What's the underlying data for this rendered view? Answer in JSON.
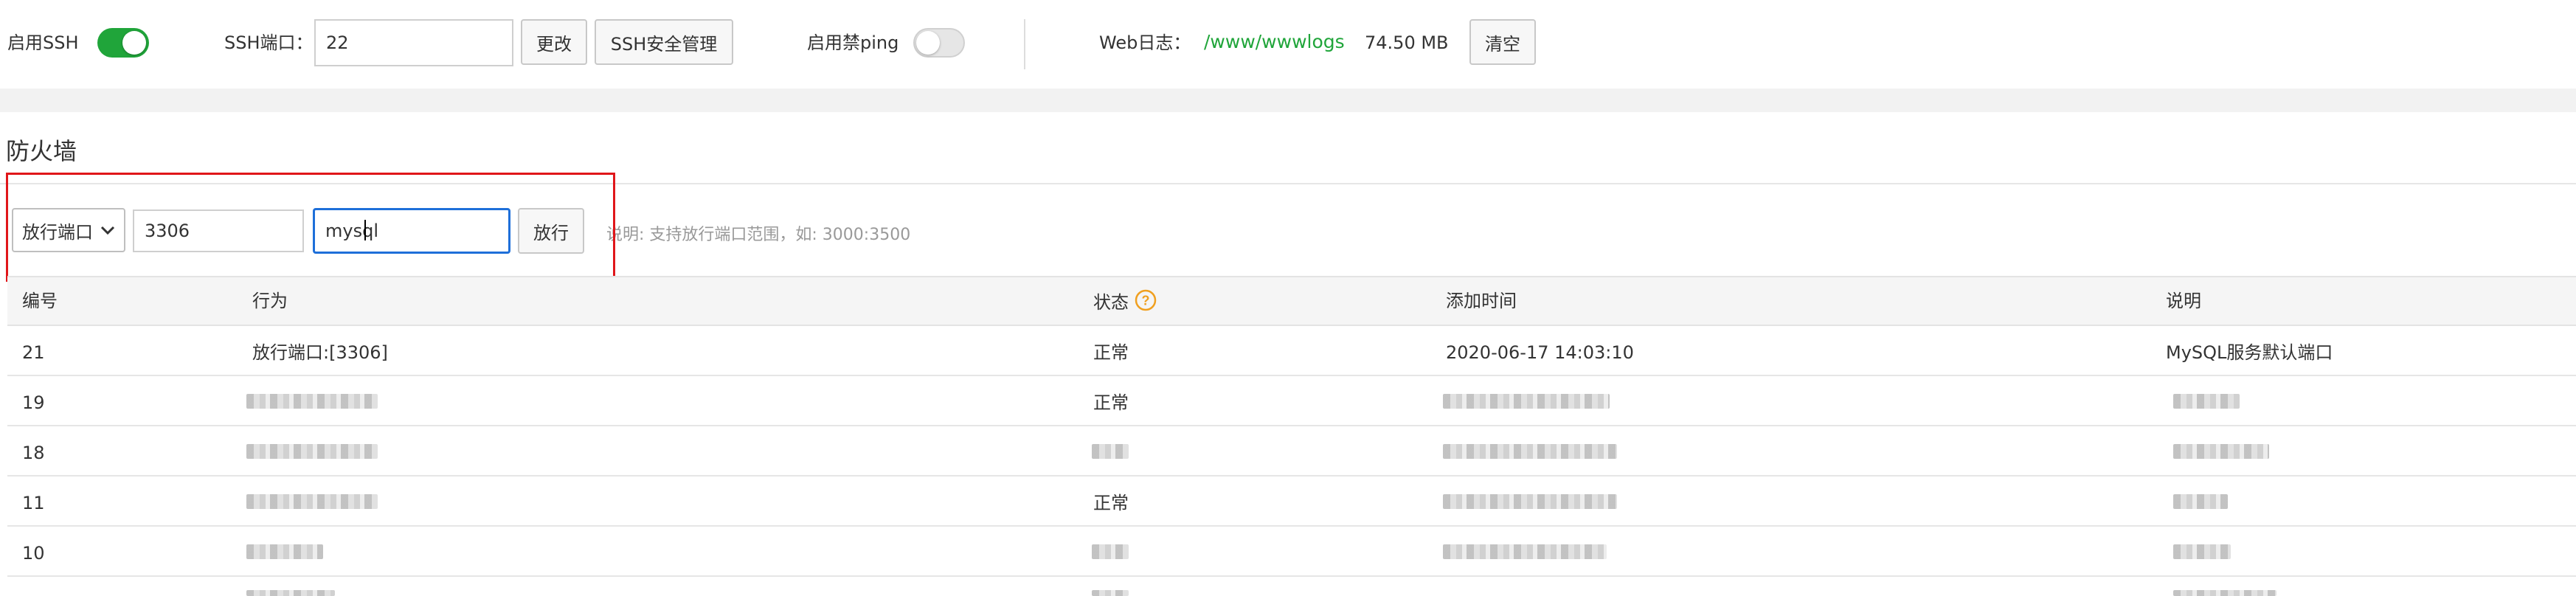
{
  "topbar": {
    "ssh_label": "启用SSH",
    "ssh_port_label": "SSH端口：",
    "ssh_port_value": "22",
    "change_button": "更改",
    "ssh_security_button": "SSH安全管理",
    "ping_label": "启用禁ping",
    "weblog_label": "Web日志：",
    "weblog_path": "/www/wwwlogs",
    "weblog_size": "74.50 MB",
    "clear_button": "清空"
  },
  "firewall": {
    "title": "防火墙",
    "rule_type_selected": "放行端口",
    "port_value": "3306",
    "desc_value": "mysql",
    "allow_button": "放行",
    "hint": "说明: 支持放行端口范围，如: 3000:3500"
  },
  "table": {
    "headers": {
      "id": "编号",
      "action": "行为",
      "status": "状态",
      "time": "添加时间",
      "desc": "说明"
    },
    "rows": [
      {
        "id": "21",
        "action": "放行端口:[3306]",
        "status": "正常",
        "time": "2020-06-17 14:03:10",
        "desc": "MySQL服务默认端口"
      },
      {
        "id": "19",
        "action": "",
        "status": "正常",
        "time": "",
        "desc": ""
      },
      {
        "id": "18",
        "action": "",
        "status": "",
        "time": "",
        "desc": ""
      },
      {
        "id": "11",
        "action": "",
        "status": "正常",
        "time": "",
        "desc": ""
      },
      {
        "id": "10",
        "action": "",
        "status": "",
        "time": "",
        "desc": ""
      }
    ]
  },
  "colors": {
    "accent_green": "#20a53a",
    "highlight_red": "#e0161a",
    "help_orange": "#f0a020",
    "focus_blue": "#1e6fd9"
  },
  "icons": {
    "select_arrow": "chevron-down-icon",
    "status_help": "question-circle-icon"
  }
}
